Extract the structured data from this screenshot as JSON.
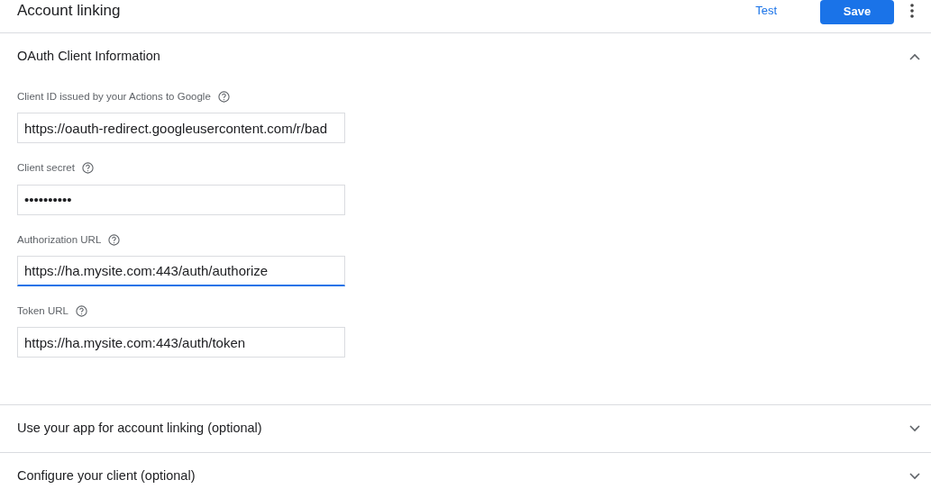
{
  "header": {
    "title": "Account linking",
    "test_link": "Test",
    "save_button": "Save"
  },
  "sections": [
    {
      "title": "OAuth Client Information",
      "expanded": true,
      "fields": [
        {
          "label": "Client ID issued by your Actions to Google",
          "value": "https://oauth-redirect.googleusercontent.com/r/bad",
          "focused": false
        },
        {
          "label": "Client secret",
          "value": "••••••••••",
          "focused": false
        },
        {
          "label": "Authorization URL",
          "value": "https://ha.mysite.com:443/auth/authorize",
          "focused": true
        },
        {
          "label": "Token URL",
          "value": "https://ha.mysite.com:443/auth/token",
          "focused": false
        }
      ]
    },
    {
      "title": "Use your app for account linking (optional)",
      "expanded": false
    },
    {
      "title": "Configure your client (optional)",
      "expanded": false
    }
  ]
}
